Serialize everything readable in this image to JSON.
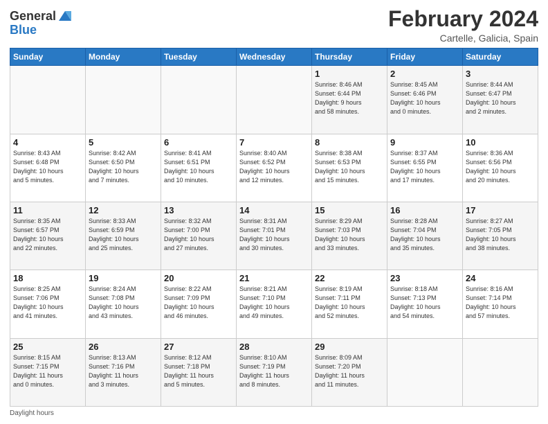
{
  "logo": {
    "general": "General",
    "blue": "Blue"
  },
  "title": {
    "month": "February 2024",
    "location": "Cartelle, Galicia, Spain"
  },
  "days_of_week": [
    "Sunday",
    "Monday",
    "Tuesday",
    "Wednesday",
    "Thursday",
    "Friday",
    "Saturday"
  ],
  "weeks": [
    [
      {
        "day": "",
        "info": ""
      },
      {
        "day": "",
        "info": ""
      },
      {
        "day": "",
        "info": ""
      },
      {
        "day": "",
        "info": ""
      },
      {
        "day": "1",
        "info": "Sunrise: 8:46 AM\nSunset: 6:44 PM\nDaylight: 9 hours\nand 58 minutes."
      },
      {
        "day": "2",
        "info": "Sunrise: 8:45 AM\nSunset: 6:46 PM\nDaylight: 10 hours\nand 0 minutes."
      },
      {
        "day": "3",
        "info": "Sunrise: 8:44 AM\nSunset: 6:47 PM\nDaylight: 10 hours\nand 2 minutes."
      }
    ],
    [
      {
        "day": "4",
        "info": "Sunrise: 8:43 AM\nSunset: 6:48 PM\nDaylight: 10 hours\nand 5 minutes."
      },
      {
        "day": "5",
        "info": "Sunrise: 8:42 AM\nSunset: 6:50 PM\nDaylight: 10 hours\nand 7 minutes."
      },
      {
        "day": "6",
        "info": "Sunrise: 8:41 AM\nSunset: 6:51 PM\nDaylight: 10 hours\nand 10 minutes."
      },
      {
        "day": "7",
        "info": "Sunrise: 8:40 AM\nSunset: 6:52 PM\nDaylight: 10 hours\nand 12 minutes."
      },
      {
        "day": "8",
        "info": "Sunrise: 8:38 AM\nSunset: 6:53 PM\nDaylight: 10 hours\nand 15 minutes."
      },
      {
        "day": "9",
        "info": "Sunrise: 8:37 AM\nSunset: 6:55 PM\nDaylight: 10 hours\nand 17 minutes."
      },
      {
        "day": "10",
        "info": "Sunrise: 8:36 AM\nSunset: 6:56 PM\nDaylight: 10 hours\nand 20 minutes."
      }
    ],
    [
      {
        "day": "11",
        "info": "Sunrise: 8:35 AM\nSunset: 6:57 PM\nDaylight: 10 hours\nand 22 minutes."
      },
      {
        "day": "12",
        "info": "Sunrise: 8:33 AM\nSunset: 6:59 PM\nDaylight: 10 hours\nand 25 minutes."
      },
      {
        "day": "13",
        "info": "Sunrise: 8:32 AM\nSunset: 7:00 PM\nDaylight: 10 hours\nand 27 minutes."
      },
      {
        "day": "14",
        "info": "Sunrise: 8:31 AM\nSunset: 7:01 PM\nDaylight: 10 hours\nand 30 minutes."
      },
      {
        "day": "15",
        "info": "Sunrise: 8:29 AM\nSunset: 7:03 PM\nDaylight: 10 hours\nand 33 minutes."
      },
      {
        "day": "16",
        "info": "Sunrise: 8:28 AM\nSunset: 7:04 PM\nDaylight: 10 hours\nand 35 minutes."
      },
      {
        "day": "17",
        "info": "Sunrise: 8:27 AM\nSunset: 7:05 PM\nDaylight: 10 hours\nand 38 minutes."
      }
    ],
    [
      {
        "day": "18",
        "info": "Sunrise: 8:25 AM\nSunset: 7:06 PM\nDaylight: 10 hours\nand 41 minutes."
      },
      {
        "day": "19",
        "info": "Sunrise: 8:24 AM\nSunset: 7:08 PM\nDaylight: 10 hours\nand 43 minutes."
      },
      {
        "day": "20",
        "info": "Sunrise: 8:22 AM\nSunset: 7:09 PM\nDaylight: 10 hours\nand 46 minutes."
      },
      {
        "day": "21",
        "info": "Sunrise: 8:21 AM\nSunset: 7:10 PM\nDaylight: 10 hours\nand 49 minutes."
      },
      {
        "day": "22",
        "info": "Sunrise: 8:19 AM\nSunset: 7:11 PM\nDaylight: 10 hours\nand 52 minutes."
      },
      {
        "day": "23",
        "info": "Sunrise: 8:18 AM\nSunset: 7:13 PM\nDaylight: 10 hours\nand 54 minutes."
      },
      {
        "day": "24",
        "info": "Sunrise: 8:16 AM\nSunset: 7:14 PM\nDaylight: 10 hours\nand 57 minutes."
      }
    ],
    [
      {
        "day": "25",
        "info": "Sunrise: 8:15 AM\nSunset: 7:15 PM\nDaylight: 11 hours\nand 0 minutes."
      },
      {
        "day": "26",
        "info": "Sunrise: 8:13 AM\nSunset: 7:16 PM\nDaylight: 11 hours\nand 3 minutes."
      },
      {
        "day": "27",
        "info": "Sunrise: 8:12 AM\nSunset: 7:18 PM\nDaylight: 11 hours\nand 5 minutes."
      },
      {
        "day": "28",
        "info": "Sunrise: 8:10 AM\nSunset: 7:19 PM\nDaylight: 11 hours\nand 8 minutes."
      },
      {
        "day": "29",
        "info": "Sunrise: 8:09 AM\nSunset: 7:20 PM\nDaylight: 11 hours\nand 11 minutes."
      },
      {
        "day": "",
        "info": ""
      },
      {
        "day": "",
        "info": ""
      }
    ]
  ],
  "footer": {
    "note": "Daylight hours"
  }
}
